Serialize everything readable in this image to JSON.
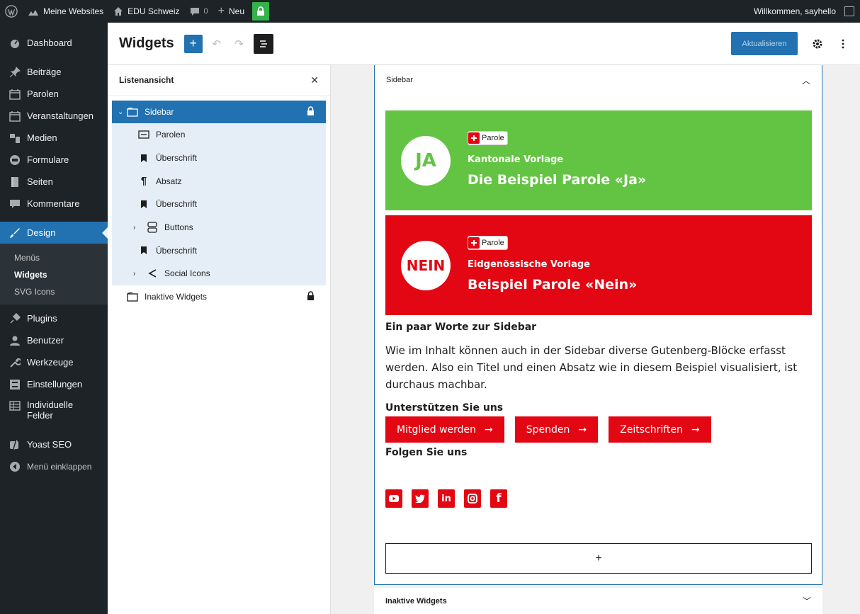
{
  "adminbar": {
    "my_sites": "Meine Websites",
    "site_name": "EDU Schweiz",
    "comments_count": "0",
    "new_label": "Neu",
    "welcome": "Willkommen, sayhello"
  },
  "menu": {
    "dashboard": "Dashboard",
    "beitraege": "Beiträge",
    "parolen": "Parolen",
    "veranstaltungen": "Veranstaltungen",
    "medien": "Medien",
    "formulare": "Formulare",
    "seiten": "Seiten",
    "kommentare": "Kommentare",
    "design": "Design",
    "design_sub": [
      "Menüs",
      "Widgets",
      "SVG Icons"
    ],
    "plugins": "Plugins",
    "benutzer": "Benutzer",
    "werkzeuge": "Werkzeuge",
    "einstellungen": "Einstellungen",
    "individuelle_line1": "Individuelle",
    "individuelle_line2": "Felder",
    "yoast": "Yoast SEO",
    "collapse": "Menü einklappen"
  },
  "header": {
    "title": "Widgets",
    "save_label": "Aktualisieren"
  },
  "listview": {
    "title": "Listenansicht",
    "sidebar": "Sidebar",
    "children": [
      "Parolen",
      "Überschrift",
      "Absatz",
      "Überschrift",
      "Buttons",
      "Überschrift",
      "Social Icons"
    ],
    "inactive": "Inaktive Widgets"
  },
  "canvas": {
    "area_title": "Sidebar",
    "parole_yes": {
      "circle": "JA",
      "badge": "Parole",
      "kind": "Kantonale Vorlage",
      "headline": "Die Beispiel Parole «Ja»"
    },
    "parole_no": {
      "circle": "NEIN",
      "badge": "Parole",
      "kind": "Eidgenössische Vorlage",
      "headline": "Beispiel Parole «Nein»"
    },
    "heading1": "Ein paar Worte zur Sidebar",
    "paragraph": "Wie im Inhalt können auch in der Sidebar diverse Gutenberg-Blöcke erfasst werden. Also ein Titel und einen Absatz wie in diesem Beispiel visualisiert, ist durchaus machbar.",
    "heading2": "Unterstützen Sie uns",
    "buttons": [
      "Mitglied werden",
      "Spenden",
      "Zeitschriften"
    ],
    "heading3": "Folgen Sie uns",
    "inactive_title": "Inaktive Widgets"
  },
  "colors": {
    "wp_dark": "#1d2327",
    "wp_blue": "#2271b1",
    "parole_green": "#63c443",
    "parole_red": "#e30613"
  }
}
